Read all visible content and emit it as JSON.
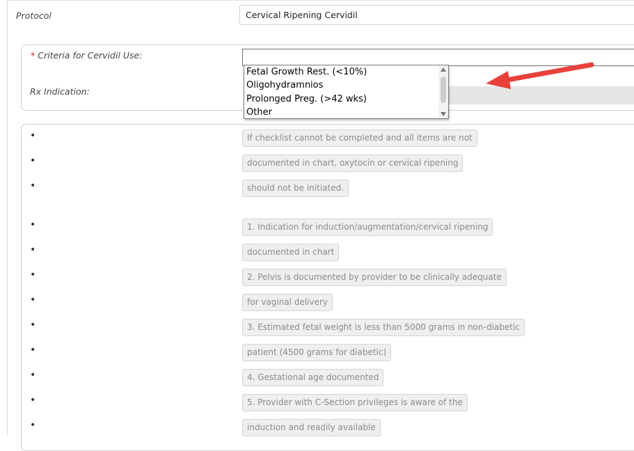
{
  "form": {
    "protocol_label": "Protocol",
    "protocol_value": "Cervical Ripening Cervidil",
    "criteria_required_marker": "*",
    "criteria_label": "Criteria for Cervidil Use:",
    "criteria_value": "",
    "rx_indication_label": "Rx Indication:"
  },
  "dropdown": {
    "options": [
      "Fetal Growth Rest. (<10%)",
      "Oligohydramnios",
      "Prolonged Preg. (>42 wks)",
      "Other"
    ]
  },
  "checklist": {
    "bullet": "•",
    "items": [
      "If checklist cannot be completed and all items are not",
      "documented in chart, oxytocin or cervical ripening",
      "should not be initiated.",
      "1. Indication for induction/augmentation/cervical ripening",
      "documented in chart",
      "2. Pelvis is documented by provider to be clinically adequate",
      "for vaginal delivery",
      "3. Estimated fetal weight is less than 5000 grams in non-diabetic",
      "patient (4500 grams for diabetic)",
      "4. Gestational age documented",
      "5. Provider with C-Section privileges is aware of the",
      "induction and readily available"
    ]
  },
  "colors": {
    "required": "#cc2222",
    "annotation_arrow": "#e8413b"
  }
}
